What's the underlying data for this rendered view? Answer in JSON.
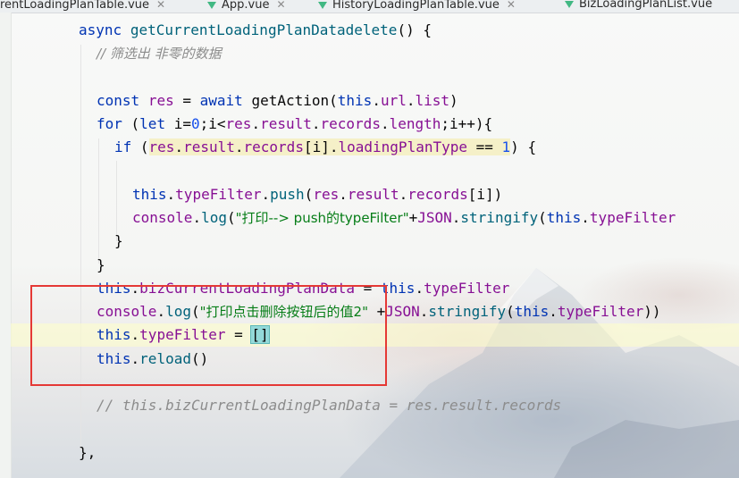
{
  "tabs": [
    {
      "label": "rentLoadingPlanTable.vue",
      "active": true
    },
    {
      "label": "App.vue",
      "active": false
    },
    {
      "label": "HistoryLoadingPlanTable.vue",
      "active": false
    },
    {
      "label": "BizLoadingPlanList.vue",
      "active": false
    }
  ],
  "code": {
    "l1": {
      "kw_async": "async",
      "fn_name": "getCurrentLoadingPlanDatadelete",
      "tail": "() {"
    },
    "l2": {
      "comment": "// 筛选出 非零的数据"
    },
    "l4": {
      "kw_const": "const",
      "var_res": "res",
      "eq": " = ",
      "kw_await": "await",
      "fn_getAction": "getAction",
      "p1": "(",
      "kw_this": "this",
      "dot1": ".",
      "prop_url": "url",
      "dot2": ".",
      "prop_list": "list",
      "p2": ")"
    },
    "l5": {
      "kw_for": "for",
      "p1": " (",
      "kw_let": "let",
      "mid1": " i=",
      "num0": "0",
      "mid2": ";i<",
      "prop_res": "res",
      "dot1": ".",
      "prop_result": "result",
      "dot2": ".",
      "prop_records": "records",
      "dot3": ".",
      "prop_length": "length",
      "tail": ";i++){"
    },
    "l6": {
      "kw_if": "if",
      "p1": " (",
      "w_res": "res",
      "w_dot1": ".",
      "w_result": "result",
      "w_dot2": ".",
      "w_records": "records",
      "w_idx": "[i]",
      "w_dot3": ".",
      "w_type": "loadingPlanType",
      "w_eq": " == ",
      "w_num": "1",
      "tail": ") {"
    },
    "l8": {
      "kw_this": "this",
      "dot1": ".",
      "prop_typeFilter": "typeFilter",
      "dot2": ".",
      "fn_push": "push",
      "p1": "(",
      "prop_res": "res",
      "dot3": ".",
      "prop_result": "result",
      "dot4": ".",
      "prop_records": "records",
      "tail": "[i])"
    },
    "l9": {
      "console": "console",
      "dot1": ".",
      "fn_log": "log",
      "p1": "(",
      "str": "\"打印--> push的typeFilter\"",
      "plus": "+",
      "json": "JSON",
      "dot2": ".",
      "fn_stringify": "stringify",
      "p2": "(",
      "kw_this": "this",
      "dot3": ".",
      "prop_typeFilter": "typeFilter"
    },
    "l10": {
      "text": "}"
    },
    "l11": {
      "text": "}"
    },
    "l12": {
      "kw_this": "this",
      "dot1": ".",
      "prop_data": "bizCurrentLoadingPlanData",
      "eq": " = ",
      "kw_this2": "this",
      "dot2": ".",
      "prop_typeFilter": "typeFilter"
    },
    "l13": {
      "console": "console",
      "dot1": ".",
      "fn_log": "log",
      "p1": "(",
      "str": "\"打印点击删除按钮后的值2\"",
      "plus": " +",
      "json": "JSON",
      "dot2": ".",
      "fn_stringify": "stringify",
      "p2": "(",
      "kw_this": "this",
      "dot3": ".",
      "prop_typeFilter": "typeFilter",
      "tail": "))"
    },
    "l14": {
      "kw_this": "this",
      "dot1": ".",
      "prop_typeFilter": "typeFilter",
      "eq": " = ",
      "brackets": "[]"
    },
    "l15": {
      "kw_this": "this",
      "dot1": ".",
      "fn_reload": "reload",
      "tail": "()"
    },
    "l17": {
      "comment": "// this.bizCurrentLoadingPlanData = res.result.records"
    },
    "l19": {
      "text": "},"
    }
  },
  "colors": {
    "keyword": "#0033b3",
    "property": "#871094",
    "string": "#067d17",
    "number": "#1750eb",
    "comment": "#8c8c8c",
    "annotation_box": "#e53935",
    "vue_icon": "#41b883"
  }
}
